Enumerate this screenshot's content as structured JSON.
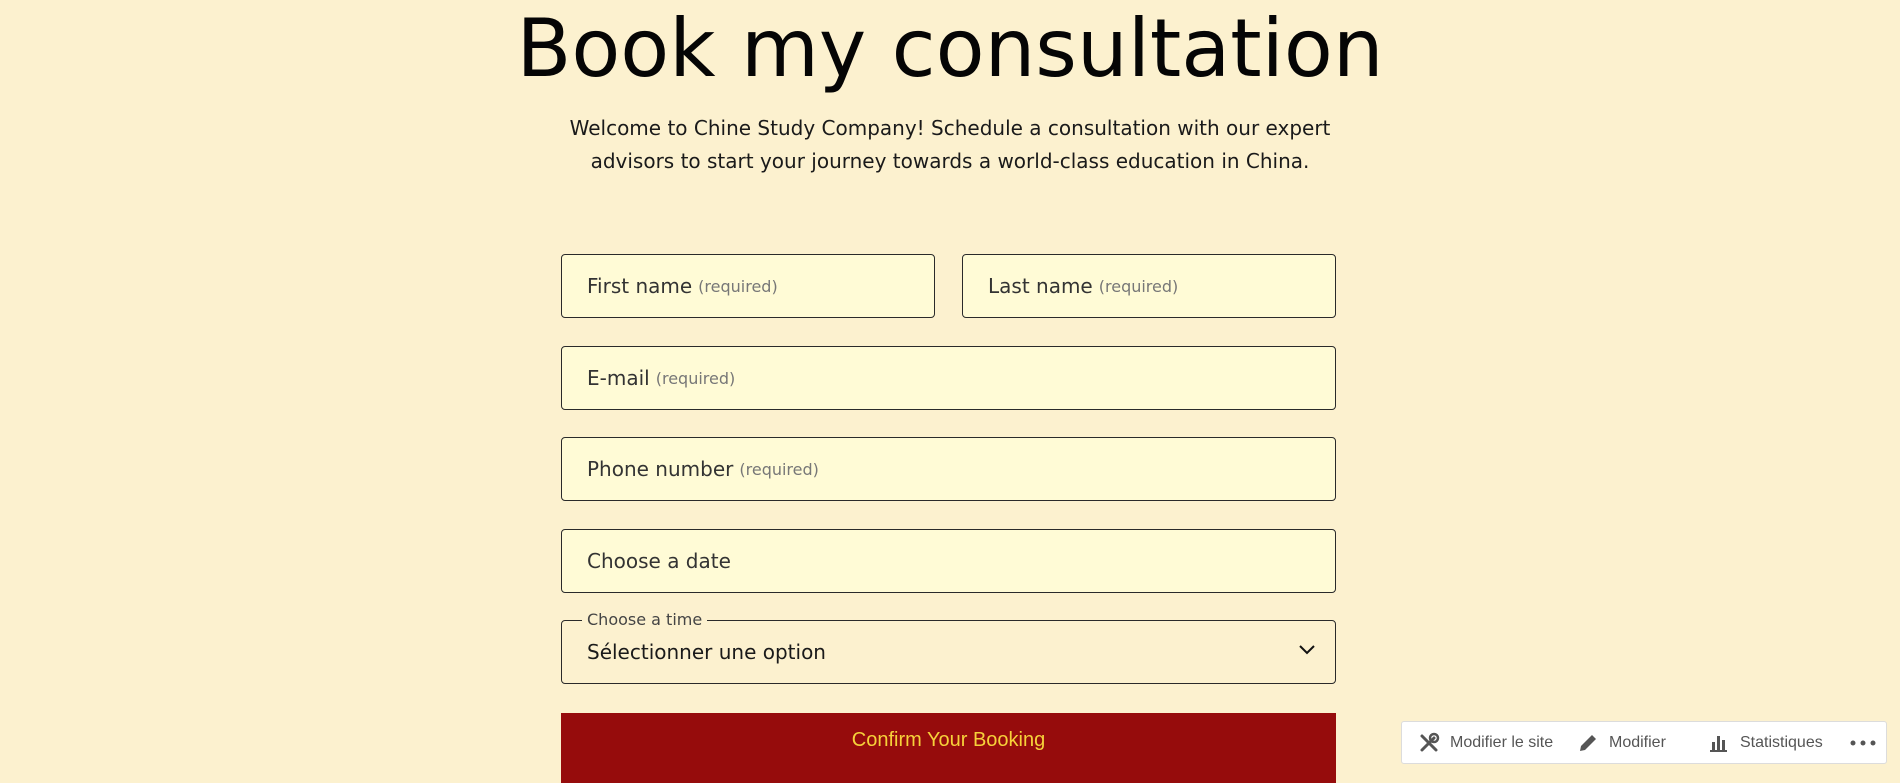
{
  "page": {
    "title": "Book my consultation",
    "intro_line1": "Welcome to Chine Study Company! Schedule a consultation with our expert",
    "intro_line2": "advisors to start your journey towards a world-class education in China."
  },
  "form": {
    "first_name": {
      "label": "First name",
      "hint": "(required)"
    },
    "last_name": {
      "label": "Last name",
      "hint": "(required)"
    },
    "email": {
      "label": "E-mail",
      "hint": "(required)"
    },
    "phone": {
      "label": "Phone number",
      "hint": "(required)"
    },
    "date": {
      "label": "Choose a date"
    },
    "time": {
      "legend": "Choose a time",
      "selected": "Sélectionner une option"
    },
    "submit_label": "Confirm Your Booking"
  },
  "admin_bar": {
    "site_label": "Modifier le site",
    "edit_label": "Modifier",
    "stats_label": "Statistiques",
    "icons": [
      "tools-icon",
      "pencil-icon",
      "bar-chart-icon",
      "more-icon"
    ]
  },
  "colors": {
    "background": "#fcf1cf",
    "field_fill": "#fffbd6",
    "button_bg": "#960c0c",
    "button_text": "#f6d13a"
  }
}
